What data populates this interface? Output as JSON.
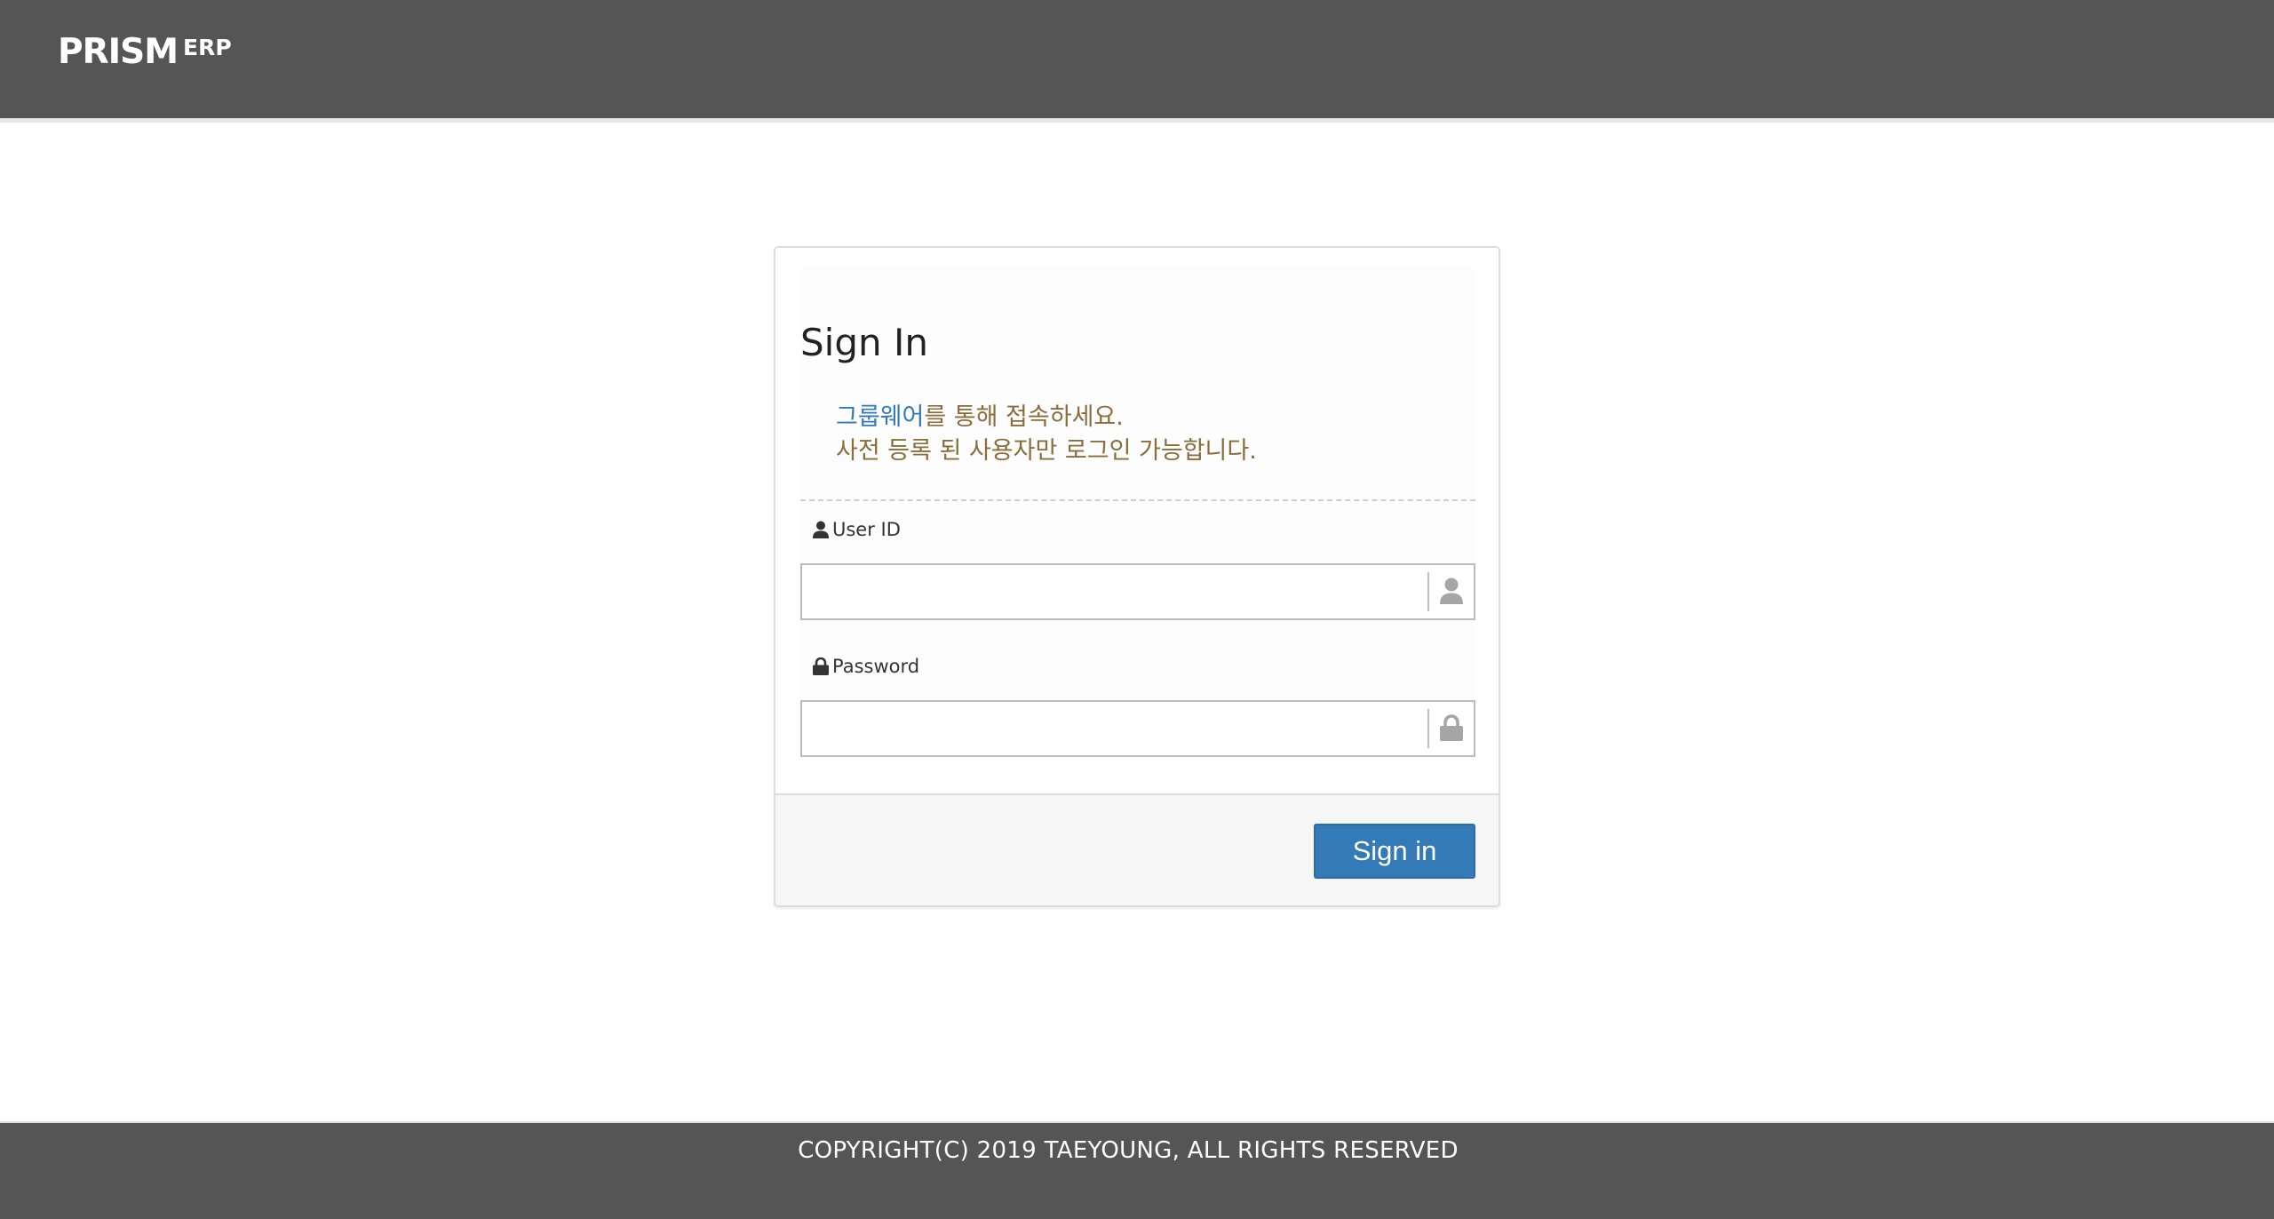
{
  "header": {
    "logo_main": "PRISM",
    "logo_sub": "ERP"
  },
  "login": {
    "title": "Sign In",
    "notice_link": "그룹웨어",
    "notice_line1_rest": "를 통해 접속하세요.",
    "notice_line2": "사전 등록 된 사용자만 로그인 가능합니다.",
    "user_id_label": "User ID",
    "user_id_value": "",
    "password_label": "Password",
    "password_value": "",
    "signin_label": "Sign in"
  },
  "footer": {
    "copyright": "COPYRIGHT(C) 2019 TAEYOUNG, ALL RIGHTS RESERVED"
  },
  "icons": {
    "user": "user-icon",
    "lock": "lock-icon"
  },
  "colors": {
    "header_bg": "#555555",
    "primary": "#337ab7",
    "notice_text": "#8a6d3b",
    "footer_bg": "#555555"
  }
}
